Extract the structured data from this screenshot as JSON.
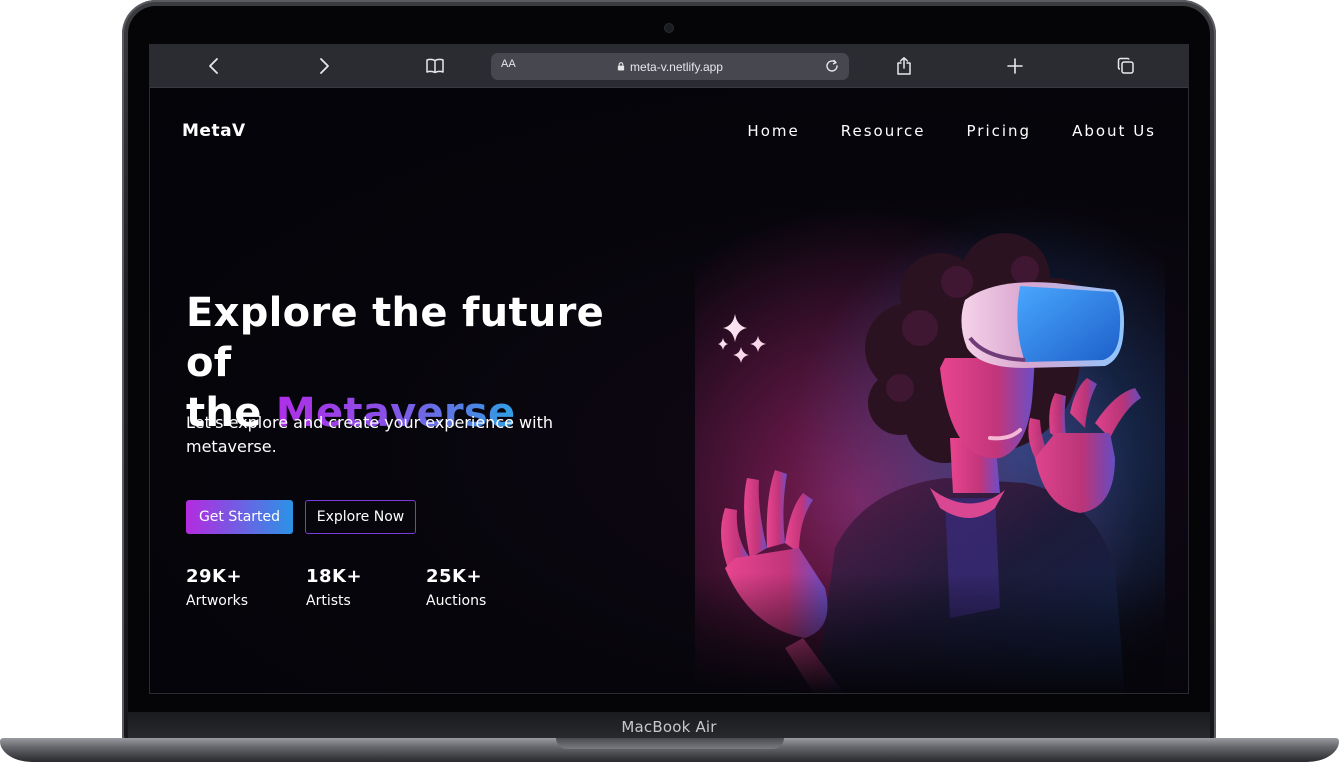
{
  "device": {
    "label": "MacBook Air"
  },
  "browser": {
    "url": "meta-v.netlify.app",
    "text_size_label": "AA",
    "icons": [
      "chevron-left-icon",
      "chevron-right-icon",
      "book-icon",
      "lock-icon",
      "reload-icon",
      "share-icon",
      "plus-icon",
      "tabs-icon"
    ]
  },
  "site": {
    "logo": "MetaV",
    "nav": [
      {
        "label": "Home"
      },
      {
        "label": "Resource"
      },
      {
        "label": "Pricing"
      },
      {
        "label": "About Us"
      }
    ],
    "hero": {
      "title_line1": "Explore the future of",
      "title_line2_plain": "the ",
      "title_line2_highlight": "Metaverse",
      "subtitle": "Let's explore and create your experience with metaverse.",
      "primary_button": "Get Started",
      "secondary_button": "Explore Now"
    },
    "stats": [
      {
        "value": "29K+",
        "label": "Artworks"
      },
      {
        "value": "18K+",
        "label": "Artists"
      },
      {
        "value": "25K+",
        "label": "Auctions"
      }
    ],
    "colors": {
      "gradient_start": "#b42be0",
      "gradient_end": "#2b93e6",
      "background": "#040409",
      "text": "#ffffff"
    },
    "image": "person-wearing-vr-headset-neon"
  }
}
